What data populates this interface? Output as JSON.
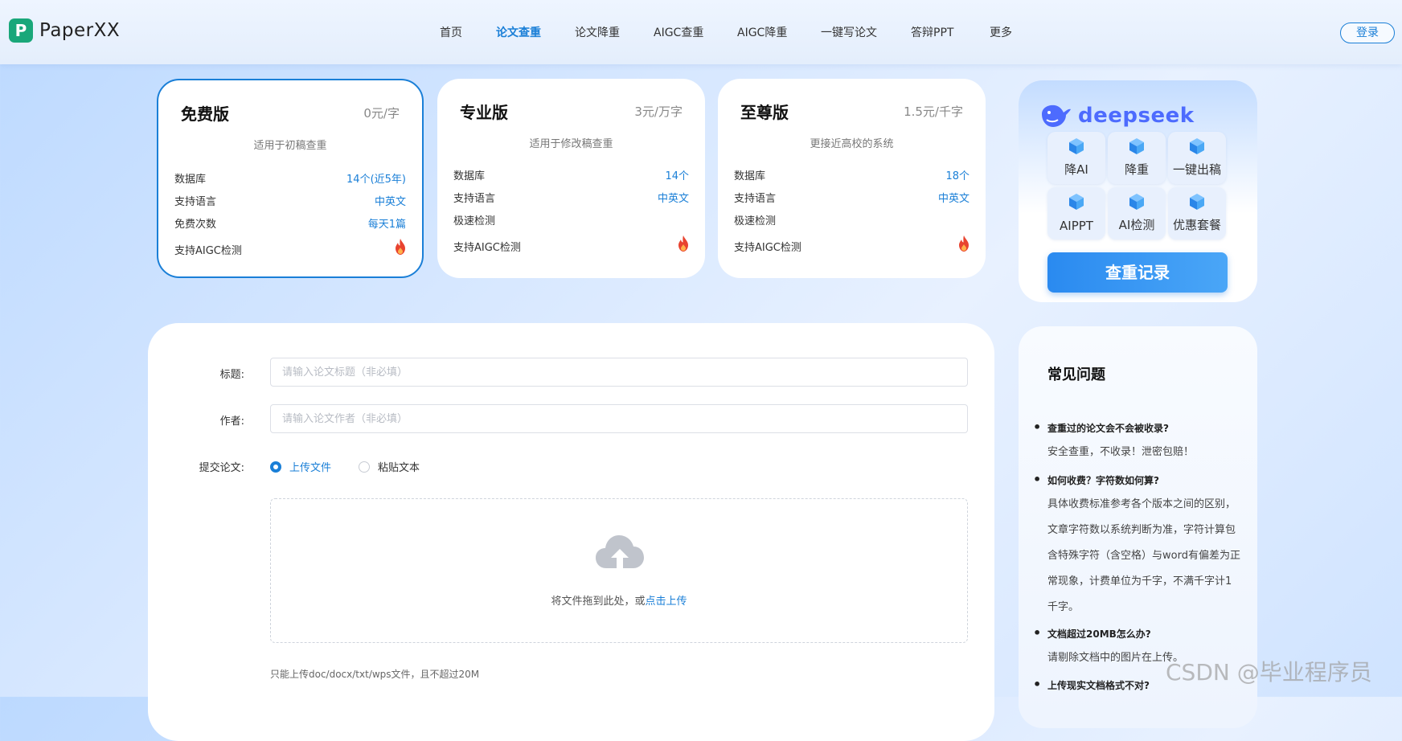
{
  "header": {
    "logo_mark": "P",
    "logo_text": "PaperXX",
    "nav": [
      {
        "label": "首页",
        "active": false
      },
      {
        "label": "论文查重",
        "active": true
      },
      {
        "label": "论文降重",
        "active": false
      },
      {
        "label": "AIGC查重",
        "active": false
      },
      {
        "label": "AIGC降重",
        "active": false
      },
      {
        "label": "一键写论文",
        "active": false
      },
      {
        "label": "答辩PPT",
        "active": false
      },
      {
        "label": "更多",
        "active": false
      }
    ],
    "login_label": "登录"
  },
  "plans": [
    {
      "name": "免费版",
      "price": "0元/字",
      "desc": "适用于初稿查重",
      "selected": true,
      "rows": [
        {
          "label": "数据库",
          "value": "14个(近5年)"
        },
        {
          "label": "支持语言",
          "value": "中英文"
        },
        {
          "label": "免费次数",
          "value": "每天1篇"
        },
        {
          "label": "支持AIGC检测",
          "value": ""
        }
      ]
    },
    {
      "name": "专业版",
      "price": "3元/万字",
      "desc": "适用于修改稿查重",
      "selected": false,
      "rows": [
        {
          "label": "数据库",
          "value": "14个"
        },
        {
          "label": "支持语言",
          "value": "中英文"
        },
        {
          "label": "极速检测",
          "value": ""
        },
        {
          "label": "支持AIGC检测",
          "value": ""
        }
      ]
    },
    {
      "name": "至尊版",
      "price": "1.5元/千字",
      "desc": "更接近高校的系统",
      "selected": false,
      "rows": [
        {
          "label": "数据库",
          "value": "18个"
        },
        {
          "label": "支持语言",
          "value": "中英文"
        },
        {
          "label": "极速检测",
          "value": ""
        },
        {
          "label": "支持AIGC检测",
          "value": ""
        }
      ]
    }
  ],
  "deepseek": {
    "brand": "deepseek",
    "tiles": [
      "降AI",
      "降重",
      "一键出稿",
      "AIPPT",
      "AI检测",
      "优惠套餐"
    ],
    "record_button": "查重记录"
  },
  "form": {
    "title_label": "标题:",
    "title_placeholder": "请输入论文标题（非必填）",
    "author_label": "作者:",
    "author_placeholder": "请输入论文作者（非必填）",
    "submit_label": "提交论文:",
    "options": [
      {
        "label": "上传文件",
        "selected": true
      },
      {
        "label": "粘贴文本",
        "selected": false
      }
    ],
    "dropzone_text": "将文件拖到此处，或",
    "dropzone_link": "点击上传",
    "upload_hint": "只能上传doc/docx/txt/wps文件，且不超过20M"
  },
  "faq": {
    "title": "常见问题",
    "items": [
      {
        "q": "查重过的论文会不会被收录?",
        "a": "安全查重，不收录！泄密包赔！"
      },
      {
        "q": "如何收费？字符数如何算?",
        "a": "具体收费标准参考各个版本之间的区别，文章字符数以系统判断为准，字符计算包含特殊字符（含空格）与word有偏差为正常现象，计费单位为千字，不满千字计1千字。"
      },
      {
        "q": "文档超过20MB怎么办?",
        "a": "请剔除文档中的图片在上传。"
      },
      {
        "q": "上传现实文档格式不对?",
        "a": ""
      }
    ]
  },
  "watermark": "CSDN @毕业程序员",
  "colors": {
    "accent": "#1a7fd7",
    "logo_green": "#19a77a",
    "deepseek_blue": "#4d6bfe",
    "fire_red": "#e8432f"
  }
}
